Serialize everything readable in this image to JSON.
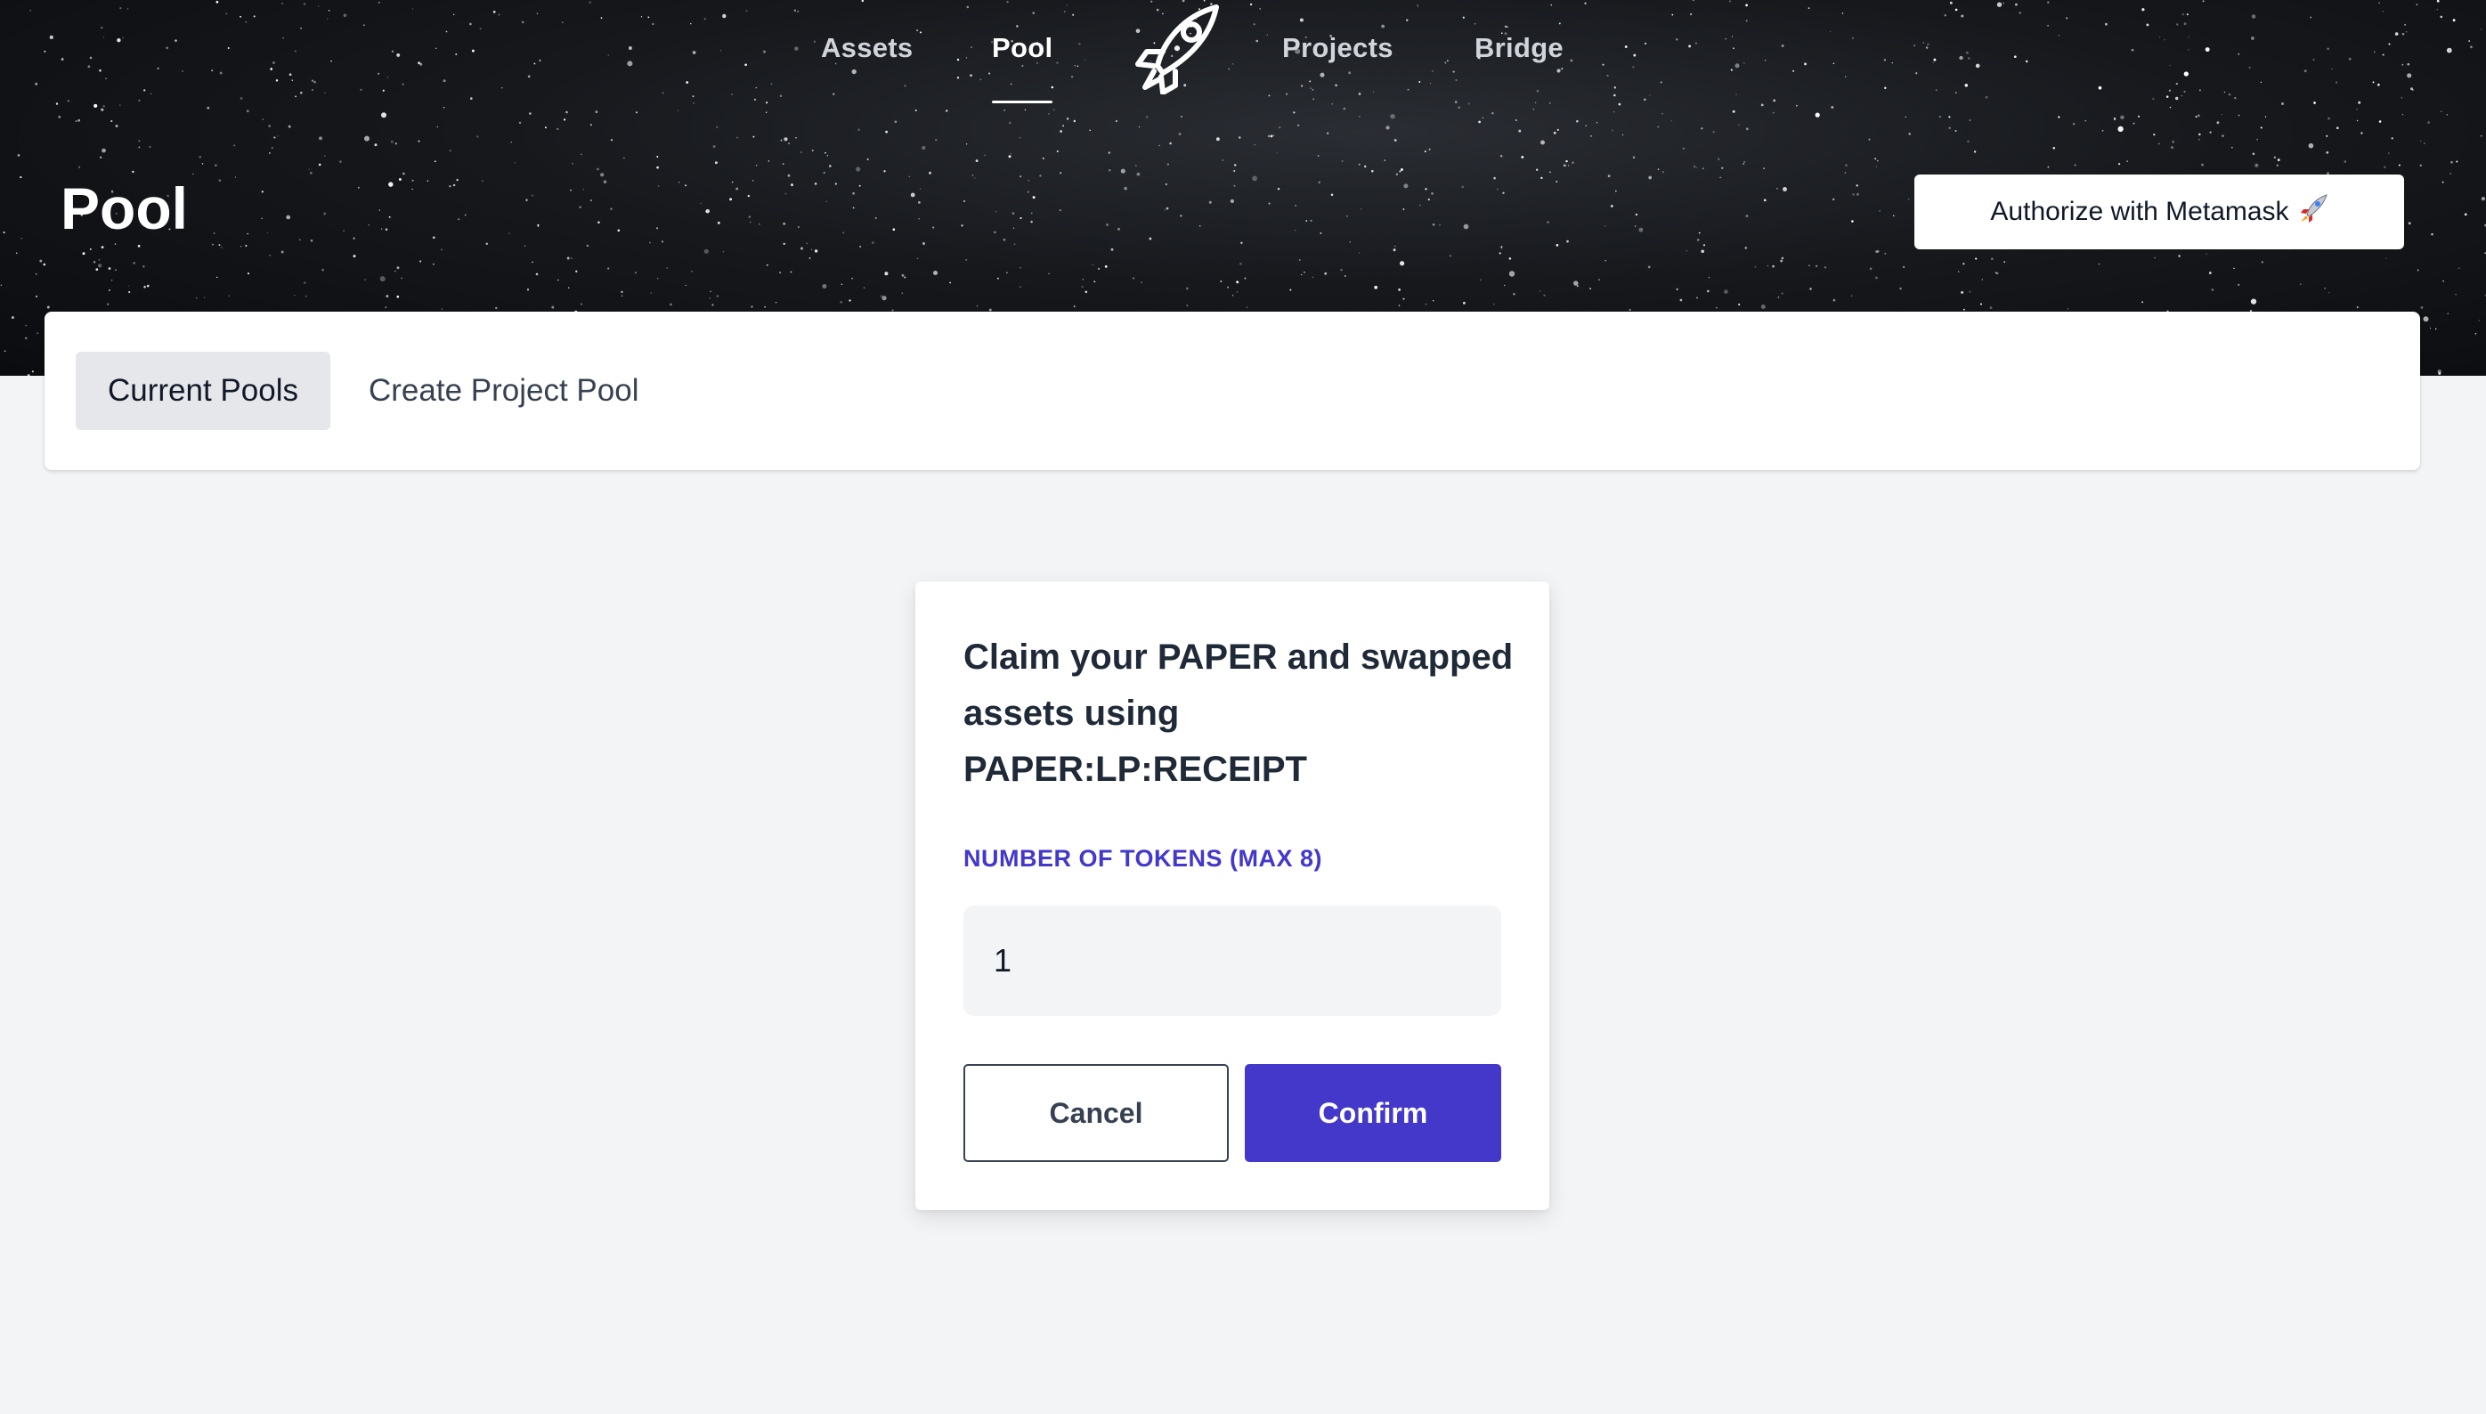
{
  "nav": {
    "items": [
      {
        "label": "Assets",
        "active": false
      },
      {
        "label": "Pool",
        "active": true
      },
      {
        "label": "Projects",
        "active": false
      },
      {
        "label": "Bridge",
        "active": false
      }
    ],
    "logo_icon": "rocket-icon"
  },
  "header": {
    "title": "Pool",
    "auth_button_label": "Authorize with Metamask",
    "auth_button_icon": "rocket-emoji-icon"
  },
  "tabs": [
    {
      "label": "Current Pools",
      "selected": true
    },
    {
      "label": "Create Project Pool",
      "selected": false
    }
  ],
  "claim_modal": {
    "title": "Claim your PAPER and swapped assets using PAPER:LP:RECEIPT",
    "field_label": "NUMBER OF TOKENS (MAX 8)",
    "tokens_value": "1",
    "cancel_label": "Cancel",
    "confirm_label": "Confirm"
  },
  "colors": {
    "accent": "#4338ca",
    "hero_background": "#0b0c0f",
    "page_background": "#f3f4f6"
  }
}
